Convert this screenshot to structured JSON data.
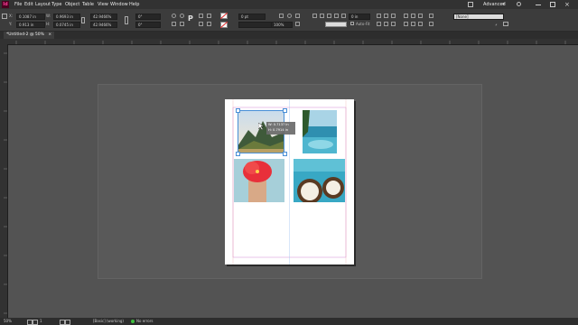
{
  "menu": {
    "items": [
      "File",
      "Edit",
      "Layout",
      "Type",
      "Object",
      "Table",
      "View",
      "Window",
      "Help"
    ],
    "workspace": "Advanced"
  },
  "control": {
    "x_label": "X:",
    "x_value": "0.1087 in",
    "y_label": "Y:",
    "y_value": "0.913 in",
    "w_label": "W:",
    "w_value": "0.9693 in",
    "h_label": "H:",
    "h_value": "0.0745 in",
    "scale_x": "42.9466%",
    "scale_y": "42.9466%",
    "angle": "0°",
    "shear": "0°",
    "stroke_weight": "0 pt",
    "size_value": "0 in",
    "opacity": "100%",
    "autofit_label": "Auto-Fit",
    "style_value": "[None]"
  },
  "document": {
    "tab_label": "*Untitled-2 @ 50%"
  },
  "selection": {
    "tooltip_line1": "W: 0.7137 in",
    "tooltip_line2": "H: 0.7914 in"
  },
  "status": {
    "zoom": "50%",
    "page_number": "1",
    "master": "[Basic] (working)",
    "preflight": "No errors"
  }
}
